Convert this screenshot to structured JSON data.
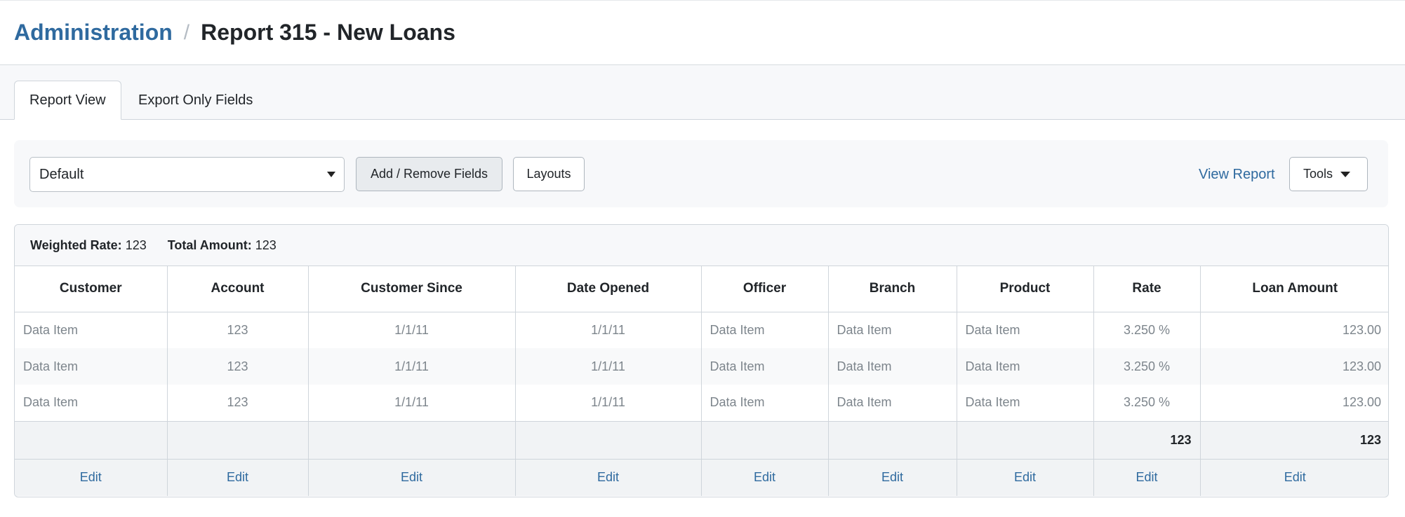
{
  "breadcrumb": {
    "parent": "Administration",
    "separator": "/",
    "current": "Report 315 - New Loans"
  },
  "tabs": [
    {
      "label": "Report View",
      "active": true
    },
    {
      "label": "Export Only Fields",
      "active": false
    }
  ],
  "toolbar": {
    "layout_select": {
      "value": "Default"
    },
    "add_remove_label": "Add / Remove Fields",
    "layouts_label": "Layouts",
    "view_report_label": "View Report",
    "tools_label": "Tools"
  },
  "summary": {
    "weighted_rate_label": "Weighted Rate:",
    "weighted_rate_value": "123",
    "total_amount_label": "Total Amount:",
    "total_amount_value": "123"
  },
  "table": {
    "columns": [
      "Customer",
      "Account",
      "Customer Since",
      "Date Opened",
      "Officer",
      "Branch",
      "Product",
      "Rate",
      "Loan Amount"
    ],
    "rows": [
      [
        "Data Item",
        "123",
        "1/1/11",
        "1/1/11",
        "Data Item",
        "Data Item",
        "Data Item",
        "3.250 %",
        "123.00"
      ],
      [
        "Data Item",
        "123",
        "1/1/11",
        "1/1/11",
        "Data Item",
        "Data Item",
        "Data Item",
        "3.250 %",
        "123.00"
      ],
      [
        "Data Item",
        "123",
        "1/1/11",
        "1/1/11",
        "Data Item",
        "Data Item",
        "Data Item",
        "3.250 %",
        "123.00"
      ]
    ],
    "totals": [
      "",
      "",
      "",
      "",
      "",
      "",
      "",
      "123",
      "123"
    ],
    "edit_label": "Edit"
  },
  "colors": {
    "link": "#2f6a9f",
    "text": "#212529",
    "muted": "#7d858c",
    "border": "#cfd5db"
  }
}
